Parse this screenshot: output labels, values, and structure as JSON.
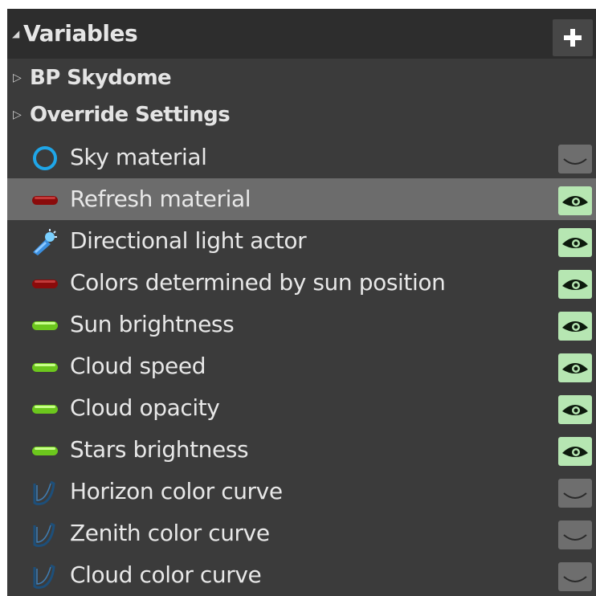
{
  "panel": {
    "title": "Variables",
    "add_button": "+"
  },
  "categories": [
    {
      "label": "BP Skydome"
    },
    {
      "label": "Override Settings"
    }
  ],
  "variables": [
    {
      "label": "Sky material",
      "type_icon": "object-ring-icon",
      "type_color": "#1fa6e8",
      "visible": false
    },
    {
      "label": "Refresh material",
      "type_icon": "pill-icon",
      "type_color": "#8a0b0b",
      "visible": true,
      "selected": true
    },
    {
      "label": "Directional light actor",
      "type_icon": "light-actor-icon",
      "type_color": "#3a8fe0",
      "visible": true
    },
    {
      "label": "Colors determined by sun position",
      "type_icon": "pill-icon",
      "type_color": "#8a0b0b",
      "visible": true
    },
    {
      "label": "Sun brightness",
      "type_icon": "pill-icon",
      "type_color": "#7fe02a",
      "visible": true
    },
    {
      "label": "Cloud speed",
      "type_icon": "pill-icon",
      "type_color": "#7fe02a",
      "visible": true
    },
    {
      "label": "Cloud opacity",
      "type_icon": "pill-icon",
      "type_color": "#7fe02a",
      "visible": true
    },
    {
      "label": "Stars brightness",
      "type_icon": "pill-icon",
      "type_color": "#7fe02a",
      "visible": true
    },
    {
      "label": "Horizon color curve",
      "type_icon": "curve-icon",
      "type_color": "#1d4f7a",
      "visible": false
    },
    {
      "label": "Zenith color curve",
      "type_icon": "curve-icon",
      "type_color": "#1d4f7a",
      "visible": false
    },
    {
      "label": "Cloud color curve",
      "type_icon": "curve-icon",
      "type_color": "#1d4f7a",
      "visible": false
    }
  ]
}
